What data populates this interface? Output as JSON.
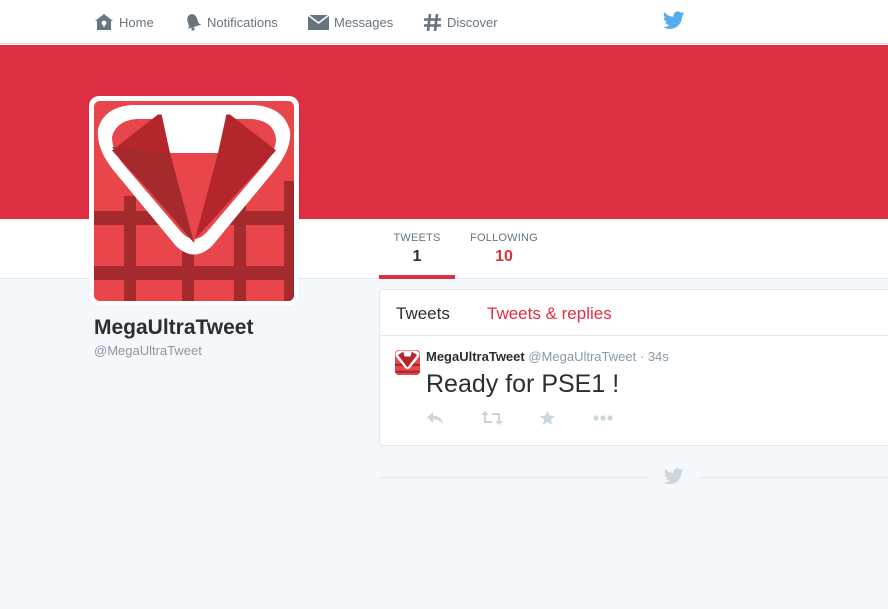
{
  "nav": {
    "items": [
      {
        "label": "Home",
        "icon": "home-icon"
      },
      {
        "label": "Notifications",
        "icon": "bell-icon"
      },
      {
        "label": "Messages",
        "icon": "envelope-icon"
      },
      {
        "label": "Discover",
        "icon": "hashtag-icon"
      }
    ],
    "logo_icon": "twitter-bird-icon"
  },
  "colors": {
    "accent": "#dd2e44",
    "link_blue": "#55acee",
    "muted": "#8899a6"
  },
  "profile": {
    "name": "MegaUltraTweet",
    "handle": "@MegaUltraTweet",
    "stats": {
      "tweets_label": "TWEETS",
      "tweets_value": "1",
      "following_label": "FOLLOWING",
      "following_value": "10"
    }
  },
  "timeline": {
    "tabs": [
      "Tweets",
      "Tweets & replies"
    ],
    "tweets": [
      {
        "name": "MegaUltraTweet",
        "handle": "@MegaUltraTweet",
        "separator": "·",
        "time": "34s",
        "text": "Ready for PSE1 !",
        "actions": [
          "reply-icon",
          "retweet-icon",
          "favorite-icon",
          "more-icon"
        ]
      }
    ],
    "end_icon": "twitter-bird-icon"
  }
}
